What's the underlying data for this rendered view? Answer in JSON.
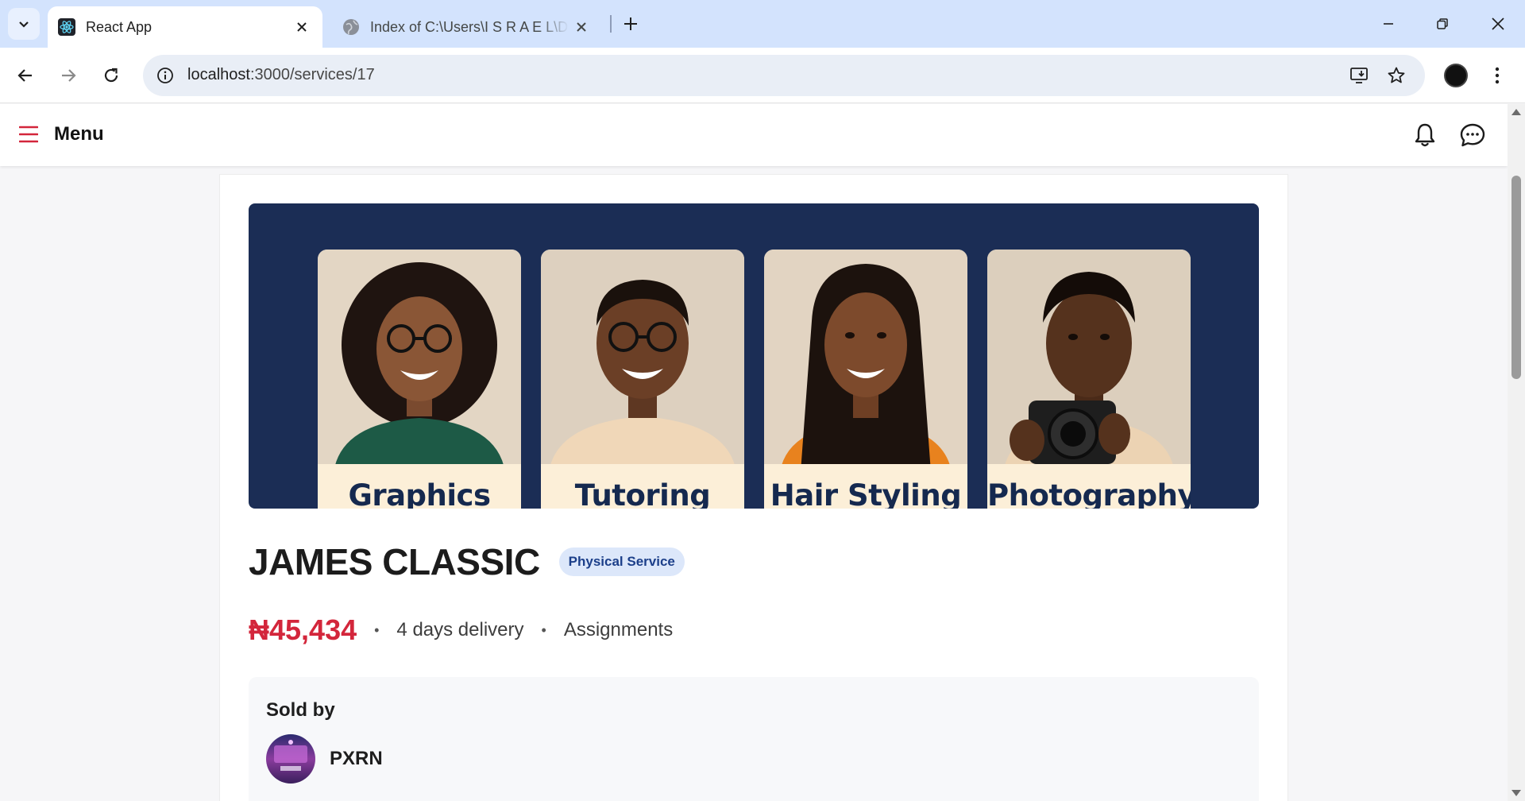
{
  "browser": {
    "tabs": [
      {
        "title": "React App",
        "icon": "react-icon",
        "active": true
      },
      {
        "title": "Index of C:\\Users\\I S R A E L\\Desktop",
        "icon": "globe-icon",
        "active": false
      }
    ],
    "url": {
      "host": "localhost",
      "path": ":3000/services/17"
    }
  },
  "appbar": {
    "menu_label": "Menu",
    "icons": [
      "hamburger-icon",
      "bell-icon",
      "chat-icon"
    ]
  },
  "service": {
    "hero_categories": [
      "Graphics",
      "Tutoring",
      "Hair Styling",
      "Photography"
    ],
    "title": "JAMES CLASSIC",
    "badge": "Physical Service",
    "price": "₦45,434",
    "delivery": "4 days delivery",
    "category": "Assignments",
    "separator": "•"
  },
  "seller": {
    "heading": "Sold by",
    "name": "PXRN"
  },
  "colors": {
    "accent": "#d3263b",
    "hero_bg": "#1b2d55",
    "badge_bg": "#dce7fa",
    "badge_text": "#1c3f8a",
    "tabstrip": "#d3e3fd"
  }
}
